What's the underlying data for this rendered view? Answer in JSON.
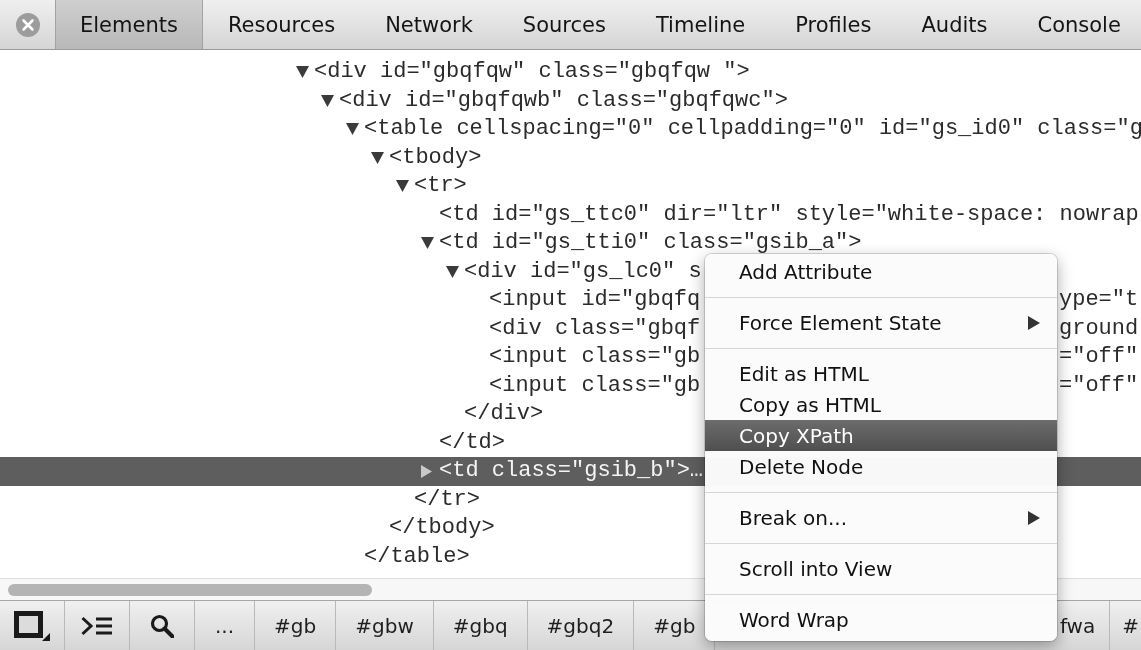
{
  "tabs": [
    {
      "label": "Elements",
      "selected": true
    },
    {
      "label": "Resources",
      "selected": false
    },
    {
      "label": "Network",
      "selected": false
    },
    {
      "label": "Sources",
      "selected": false
    },
    {
      "label": "Timeline",
      "selected": false
    },
    {
      "label": "Profiles",
      "selected": false
    },
    {
      "label": "Audits",
      "selected": false
    },
    {
      "label": "Console",
      "selected": false
    }
  ],
  "dom_tree": [
    {
      "tag": "<div id=\"gbqfqw\" class=\"gbqfqw \">",
      "expanded": true,
      "selected": false,
      "children": [
        {
          "tag": "<div id=\"gbqfqwb\" class=\"gbqfqwc\">",
          "expanded": true,
          "selected": false,
          "children": [
            {
              "tag": "<table cellspacing=\"0\" cellpadding=\"0\" id=\"gs_id0\" class=\"g",
              "expanded": true,
              "selected": false,
              "closing_tag": "</table>",
              "children": [
                {
                  "tag": "<tbody>",
                  "expanded": true,
                  "selected": false,
                  "closing_tag": "</tbody>",
                  "children": [
                    {
                      "tag": "<tr>",
                      "expanded": true,
                      "selected": false,
                      "closing_tag": "</tr>",
                      "children": [
                        {
                          "tag": "<td id=\"gs_ttc0\" dir=\"ltr\" style=\"white-space: nowrap",
                          "selected": false
                        },
                        {
                          "tag": "<td id=\"gs_tti0\" class=\"gsib_a\">",
                          "expanded": true,
                          "selected": false,
                          "closing_tag": "</td>",
                          "children": [
                            {
                              "tag": "<div id=\"gs_lc0\" s",
                              "expanded": true,
                              "selected": false,
                              "closing_tag": "</div>",
                              "children": [
                                {
                                  "tag": "<input id=\"gbqfq",
                                  "tail": "ype=\"t",
                                  "selected": false
                                },
                                {
                                  "tag": "<div class=\"gbqf",
                                  "tail": "ground",
                                  "selected": false
                                },
                                {
                                  "tag": "<input class=\"gb",
                                  "tail": "=\"off\"",
                                  "selected": false
                                },
                                {
                                  "tag": "<input class=\"gb",
                                  "tail": "=\"off\"",
                                  "selected": false
                                }
                              ]
                            }
                          ]
                        },
                        {
                          "tag": "<td class=\"gsib_b\">…",
                          "expanded": false,
                          "selected": true
                        }
                      ]
                    }
                  ]
                }
              ]
            }
          ]
        }
      ]
    }
  ],
  "context_menu": {
    "groups": [
      [
        {
          "label": "Add Attribute",
          "selected": false,
          "submenu": false
        }
      ],
      [
        {
          "label": "Force Element State",
          "selected": false,
          "submenu": true
        }
      ],
      [
        {
          "label": "Edit as HTML",
          "selected": false,
          "submenu": false
        },
        {
          "label": "Copy as HTML",
          "selected": false,
          "submenu": false
        },
        {
          "label": "Copy XPath",
          "selected": true,
          "submenu": false
        },
        {
          "label": "Delete Node",
          "selected": false,
          "submenu": false
        }
      ],
      [
        {
          "label": "Break on...",
          "selected": false,
          "submenu": true
        }
      ],
      [
        {
          "label": "Scroll into View",
          "selected": false,
          "submenu": false
        }
      ],
      [
        {
          "label": "Word Wrap",
          "selected": false,
          "submenu": false
        }
      ]
    ]
  },
  "bottom_bar": {
    "breadcrumbs": [
      "...",
      "#gb",
      "#gbw",
      "#gbq",
      "#gbq2",
      "#gb"
    ],
    "breadcrumbs_right": [
      "fwa",
      "#"
    ]
  }
}
